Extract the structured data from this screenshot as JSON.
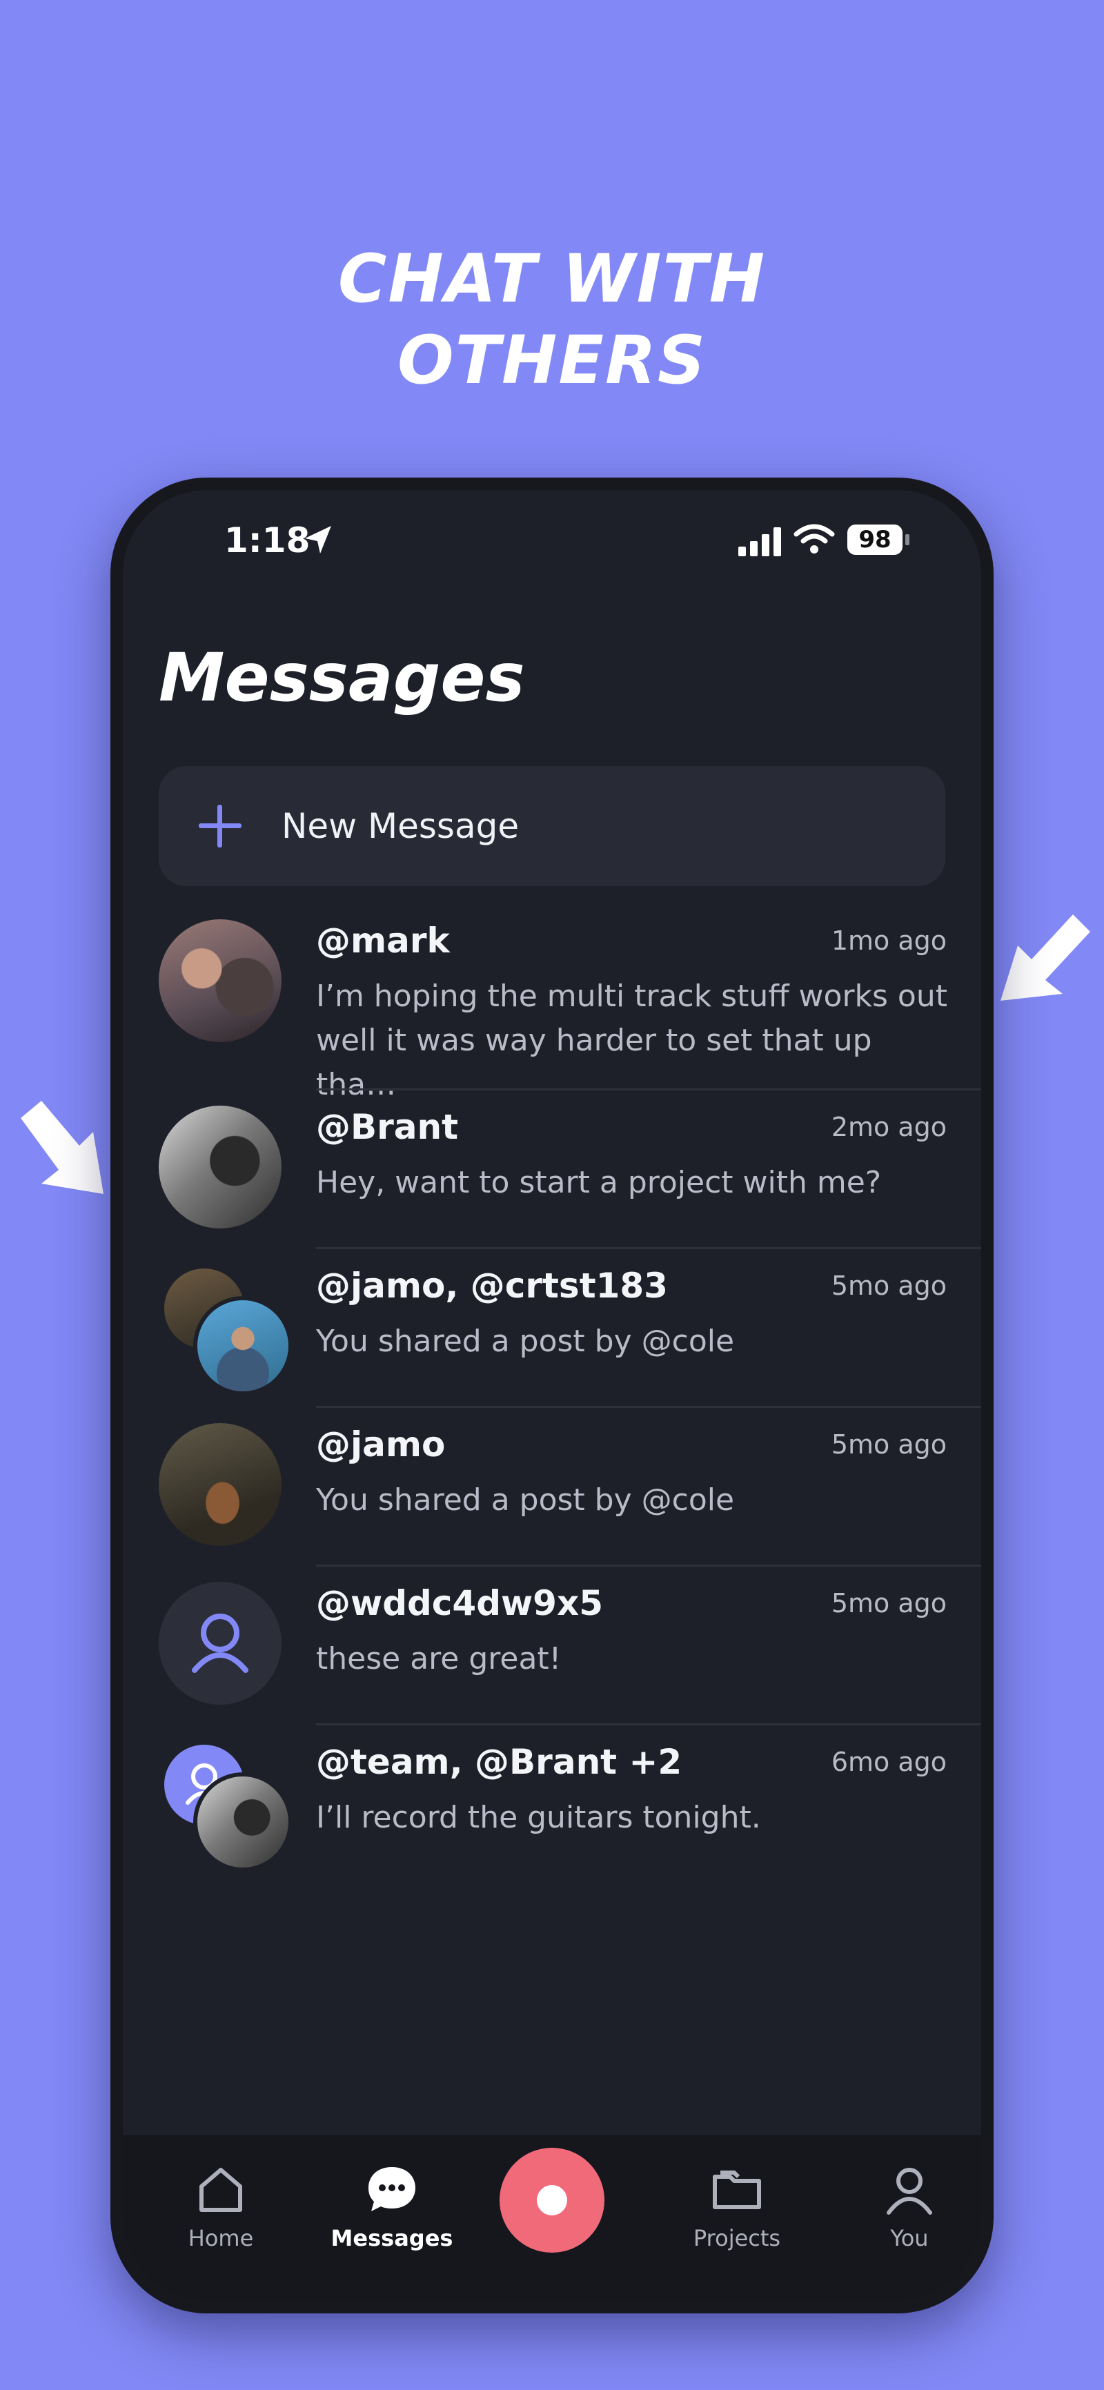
{
  "headline": {
    "line1": "Chat with",
    "line2": "others"
  },
  "status_bar": {
    "time": "1:18",
    "battery": "98"
  },
  "page_title": "Messages",
  "new_message": {
    "label": "New Message"
  },
  "conversations": [
    {
      "name": "@mark",
      "time": "1mo ago",
      "preview": "I’m hoping the multi track stuff works out well it was way harder to set that up tha…"
    },
    {
      "name": "@Brant",
      "time": "2mo ago",
      "preview": "Hey, want to start a project with me?"
    },
    {
      "name": "@jamo, @crtst183",
      "time": "5mo ago",
      "preview": "You shared a post by @cole"
    },
    {
      "name": "@jamo",
      "time": "5mo ago",
      "preview": "You shared a post by @cole"
    },
    {
      "name": "@wddc4dw9x5",
      "time": "5mo ago",
      "preview": "these are great!"
    },
    {
      "name": "@team, @Brant +2",
      "time": "6mo ago",
      "preview": "I’ll record the guitars tonight."
    }
  ],
  "tab_bar": {
    "home": "Home",
    "messages": "Messages",
    "projects": "Projects",
    "you": "You"
  },
  "colors": {
    "background": "#8289f6",
    "screen": "#1e2029",
    "accent": "#8289f6",
    "record": "#f06a7a"
  }
}
